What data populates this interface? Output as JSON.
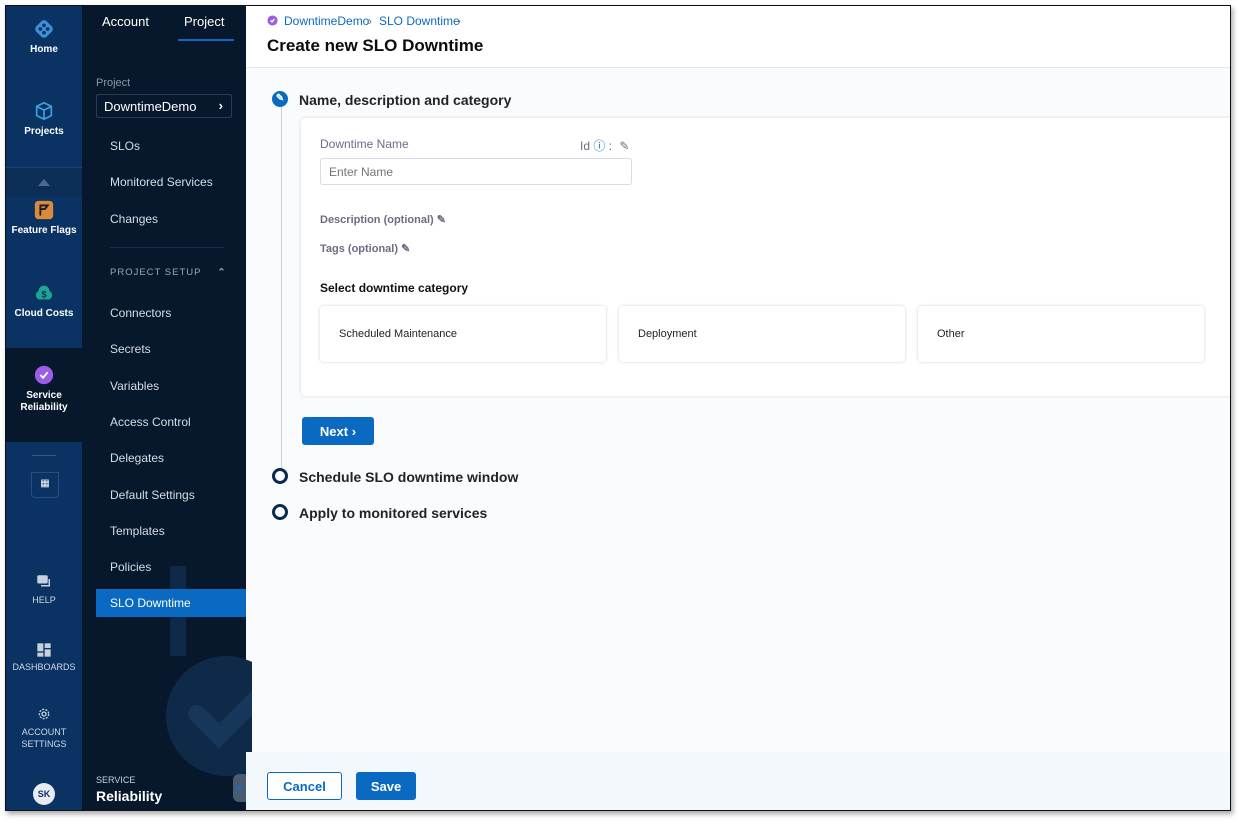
{
  "nav_primary": {
    "items": [
      {
        "label": "Home",
        "icon": "home-icon"
      },
      {
        "label": "Projects",
        "icon": "cube-icon"
      },
      {
        "label": "Feature Flags",
        "icon": "flag-icon"
      },
      {
        "label": "Cloud Costs",
        "icon": "cloud-dollar-icon"
      },
      {
        "label": "Service Reliability",
        "icon": "service-reliability-icon",
        "active": true
      }
    ],
    "bottom": [
      {
        "label": "HELP",
        "icon": "help-icon"
      },
      {
        "label": "DASHBOARDS",
        "icon": "dashboard-icon"
      },
      {
        "label": "ACCOUNT SETTINGS",
        "icon": "gear-icon"
      }
    ],
    "avatar": "SK"
  },
  "nav_secondary": {
    "tabs": [
      "Account",
      "Project"
    ],
    "active_tab": "Project",
    "project_label": "Project",
    "project_value": "DowntimeDemo",
    "items": [
      "SLOs",
      "Monitored Services",
      "Changes"
    ],
    "section": "PROJECT SETUP",
    "setup_items": [
      "Connectors",
      "Secrets",
      "Variables",
      "Access Control",
      "Delegates",
      "Default Settings",
      "Templates",
      "Policies",
      "SLO Downtime"
    ],
    "active_item": "SLO Downtime",
    "module_small": "SERVICE",
    "module_big": "Reliability"
  },
  "header": {
    "breadcrumb": [
      "DowntimeDemo",
      "SLO Downtime"
    ],
    "title": "Create new SLO Downtime"
  },
  "steps": [
    {
      "label": "Name, description and category",
      "active": true
    },
    {
      "label": "Schedule SLO downtime window"
    },
    {
      "label": "Apply to monitored services"
    }
  ],
  "form": {
    "name_label": "Downtime Name",
    "id_label": "Id",
    "name_placeholder": "Enter Name",
    "description_label": "Description (optional)",
    "tags_label": "Tags (optional)",
    "category_label": "Select downtime category",
    "categories": [
      "Scheduled Maintenance",
      "Deployment",
      "Other"
    ],
    "next_label": "Next"
  },
  "footer": {
    "cancel": "Cancel",
    "save": "Save"
  },
  "colors": {
    "accent": "#0a6ac2",
    "nav_primary": "#0a3364",
    "nav_secondary": "#07182c"
  }
}
